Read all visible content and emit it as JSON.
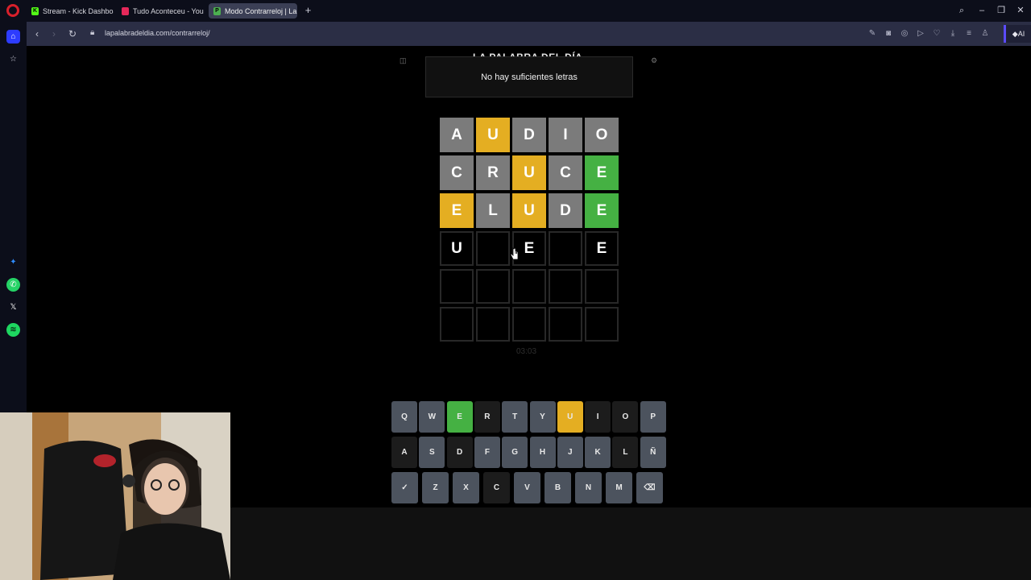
{
  "browser": {
    "tabs": [
      {
        "label": "Stream - Kick Dashboard",
        "fav_color": "#53fc18",
        "fav_char": "K",
        "active": false
      },
      {
        "label": "Tudo Aconteceu - You",
        "fav_color": "#e5285a",
        "fav_char": "",
        "active": false
      },
      {
        "label": "Modo Contrarreloj | La pa",
        "fav_color": "#4caf50",
        "fav_char": "P",
        "active": true
      }
    ],
    "url": "lapalabradeldia.com/contrarreloj/"
  },
  "game": {
    "site_title": "LA PALABRA DEL DÍA",
    "toast": "No hay suficientes letras",
    "timer": "03:03",
    "board": [
      [
        {
          "l": "A",
          "s": "gray"
        },
        {
          "l": "U",
          "s": "yellow"
        },
        {
          "l": "D",
          "s": "gray"
        },
        {
          "l": "I",
          "s": "gray"
        },
        {
          "l": "O",
          "s": "gray"
        }
      ],
      [
        {
          "l": "C",
          "s": "gray"
        },
        {
          "l": "R",
          "s": "gray"
        },
        {
          "l": "U",
          "s": "yellow"
        },
        {
          "l": "C",
          "s": "gray"
        },
        {
          "l": "E",
          "s": "green"
        }
      ],
      [
        {
          "l": "E",
          "s": "yellow"
        },
        {
          "l": "L",
          "s": "gray"
        },
        {
          "l": "U",
          "s": "yellow"
        },
        {
          "l": "D",
          "s": "gray"
        },
        {
          "l": "E",
          "s": "green"
        }
      ],
      [
        {
          "l": "U",
          "s": "empty"
        },
        {
          "l": "",
          "s": "empty"
        },
        {
          "l": "E",
          "s": "empty"
        },
        {
          "l": "",
          "s": "empty"
        },
        {
          "l": "E",
          "s": "empty"
        }
      ],
      [
        {
          "l": "",
          "s": "empty"
        },
        {
          "l": "",
          "s": "empty"
        },
        {
          "l": "",
          "s": "empty"
        },
        {
          "l": "",
          "s": "empty"
        },
        {
          "l": "",
          "s": "empty"
        }
      ],
      [
        {
          "l": "",
          "s": "empty"
        },
        {
          "l": "",
          "s": "empty"
        },
        {
          "l": "",
          "s": "empty"
        },
        {
          "l": "",
          "s": "empty"
        },
        {
          "l": "",
          "s": "empty"
        }
      ]
    ],
    "keyboard": [
      [
        {
          "k": "Q",
          "s": "normal"
        },
        {
          "k": "W",
          "s": "normal"
        },
        {
          "k": "E",
          "s": "green"
        },
        {
          "k": "R",
          "s": "dark"
        },
        {
          "k": "T",
          "s": "normal"
        },
        {
          "k": "Y",
          "s": "normal"
        },
        {
          "k": "U",
          "s": "yellow"
        },
        {
          "k": "I",
          "s": "dark"
        },
        {
          "k": "O",
          "s": "dark"
        },
        {
          "k": "P",
          "s": "normal"
        }
      ],
      [
        {
          "k": "A",
          "s": "dark"
        },
        {
          "k": "S",
          "s": "normal"
        },
        {
          "k": "D",
          "s": "dark"
        },
        {
          "k": "F",
          "s": "normal"
        },
        {
          "k": "G",
          "s": "normal"
        },
        {
          "k": "H",
          "s": "normal"
        },
        {
          "k": "J",
          "s": "normal"
        },
        {
          "k": "K",
          "s": "normal"
        },
        {
          "k": "L",
          "s": "dark"
        },
        {
          "k": "Ñ",
          "s": "normal"
        }
      ],
      [
        {
          "k": "✓",
          "s": "normal"
        },
        {
          "k": "Z",
          "s": "normal"
        },
        {
          "k": "X",
          "s": "normal"
        },
        {
          "k": "C",
          "s": "dark"
        },
        {
          "k": "V",
          "s": "normal"
        },
        {
          "k": "B",
          "s": "normal"
        },
        {
          "k": "N",
          "s": "normal"
        },
        {
          "k": "M",
          "s": "normal"
        },
        {
          "k": "⌫",
          "s": "normal"
        }
      ]
    ]
  },
  "colors": {
    "gray": "#7b7b7b",
    "yellow": "#e4ae22",
    "green": "#45b143"
  }
}
